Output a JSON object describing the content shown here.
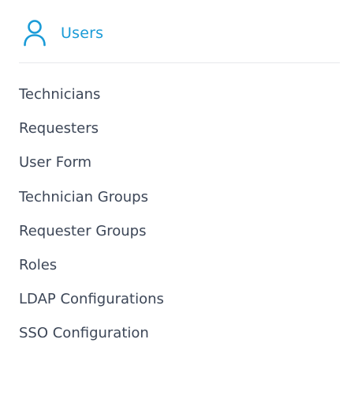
{
  "header": {
    "icon": "user-icon",
    "title": "Users",
    "accent_color": "#1a9bd7"
  },
  "menu": {
    "items": [
      {
        "label": "Technicians"
      },
      {
        "label": "Requesters"
      },
      {
        "label": "User Form"
      },
      {
        "label": "Technician Groups"
      },
      {
        "label": "Requester Groups"
      },
      {
        "label": "Roles"
      },
      {
        "label": "LDAP Configurations"
      },
      {
        "label": "SSO Configuration"
      }
    ]
  }
}
